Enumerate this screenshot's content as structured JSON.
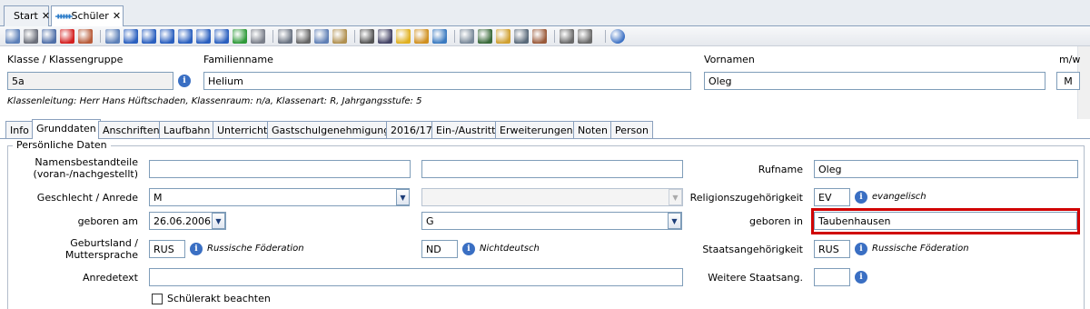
{
  "tabs": [
    {
      "label": "Start",
      "close": "✕"
    },
    {
      "label": "Schüler",
      "close": "✕"
    }
  ],
  "toolbar_icons": [
    "new-icon",
    "save-icon",
    "undo-icon",
    "delete-icon",
    "cancel-edit-icon",
    "copy-record-icon",
    "first-record-icon",
    "prev-page-icon",
    "prev-record-icon",
    "next-record-icon",
    "next-page-icon",
    "last-record-icon",
    "refresh-icon",
    "list-icon",
    "back-arrow-icon",
    "cut-icon",
    "copy-icon",
    "paste-icon",
    "print-icon",
    "preview-icon",
    "hint-icon",
    "broom-icon",
    "history-icon",
    "database-icon",
    "user-icon",
    "export-icon",
    "grid-icon",
    "contact-card-icon",
    "home-icon",
    "home-alt-icon",
    "help-icon"
  ],
  "header": {
    "class_label": "Klasse / Klassengruppe",
    "class_value": "5a",
    "lastname_label": "Familienname",
    "lastname_value": "Helium",
    "firstname_label": "Vornamen",
    "firstname_value": "Oleg",
    "gender_label": "m/w",
    "gender_value": "M",
    "info_text": "Klassenleitung: Herr Hans Hüftschaden, Klassenraum: n/a, Klassenart: R, Jahrgangsstufe: 5"
  },
  "section_tabs": [
    "Info",
    "Grunddaten",
    "Anschriften",
    "Laufbahn",
    "Unterricht",
    "Gastschulgenehmigung",
    "2016/17",
    "Ein-/Austritt",
    "Erweiterungen",
    "Noten",
    "Person"
  ],
  "group": {
    "title": "Persönliche Daten",
    "name_parts_label_1": "Namensbestandteile",
    "name_parts_label_2": "(voran-/nachgestellt)",
    "name_prefix": "",
    "name_suffix": "",
    "rufname_label": "Rufname",
    "rufname_value": "Oleg",
    "gender_label": "Geschlecht / Anrede",
    "gender_value": "M",
    "salutation_value": "",
    "religion_label": "Religionszugehörigkeit",
    "religion_code": "EV",
    "religion_text": "evangelisch",
    "birthdate_label": "geboren am",
    "birthdate_value": "26.06.2006",
    "birth_select_value": "G",
    "birthplace_label": "geboren in",
    "birthplace_value": "Taubenhausen",
    "country_label_1": "Geburtsland /",
    "country_label_2": "Muttersprache",
    "country_code": "RUS",
    "country_text": "Russische Föderation",
    "language_code": "ND",
    "language_text": "Nichtdeutsch",
    "nationality_label": "Staatsangehörigkeit",
    "nationality_code": "RUS",
    "nationality_text": "Russische Föderation",
    "anrede_label": "Anredetext",
    "anrede_value": "",
    "more_nat_label": "Weitere Staatsang.",
    "more_nat_value": "",
    "checkbox_label": "Schülerakt beachten"
  },
  "colors": {
    "highlight": "#d00000",
    "info_icon": "#3a6fc3"
  }
}
